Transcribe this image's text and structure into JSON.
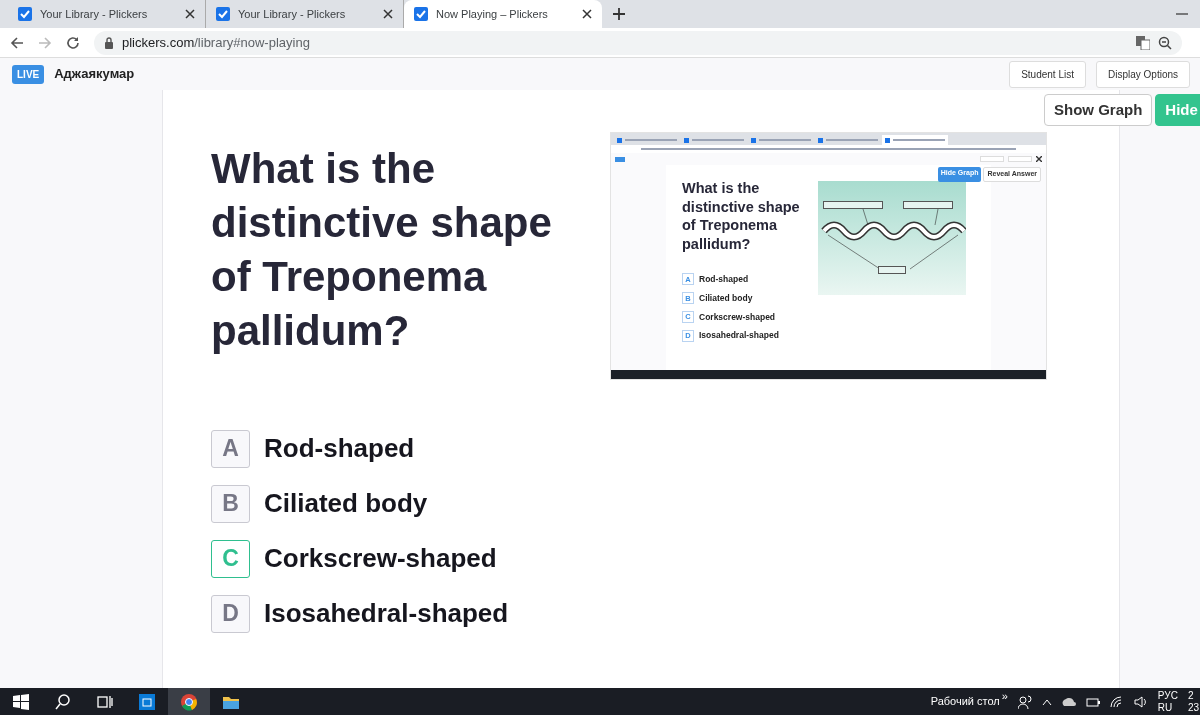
{
  "browser": {
    "tabs": [
      {
        "title": "Your Library - Plickers",
        "selected": false
      },
      {
        "title": "Your Library - Plickers",
        "selected": false
      },
      {
        "title": "Now Playing – Plickers",
        "selected": true
      }
    ],
    "url_host": "plickers.com",
    "url_path": "/library#now-playing"
  },
  "header": {
    "badge": "LIVE",
    "class_name": "Аджаякумар",
    "buttons": [
      "Student List",
      "Display Options"
    ]
  },
  "stage_buttons": [
    {
      "label": "Show Graph",
      "kind": "outline"
    },
    {
      "label": "Hide",
      "kind": "filled"
    }
  ],
  "question": "What is the distinctive shape of Treponema pallidum?",
  "choices": [
    {
      "letter": "A",
      "text": "Rod-shaped",
      "highlighted": false
    },
    {
      "letter": "B",
      "text": "Ciliated body",
      "highlighted": false
    },
    {
      "letter": "C",
      "text": "Corkscrew-shaped",
      "highlighted": true
    },
    {
      "letter": "D",
      "text": "Isosahedral-shaped",
      "highlighted": false
    }
  ],
  "inner_screen": {
    "tabs": [
      {
        "selected": false
      },
      {
        "selected": false
      },
      {
        "selected": false
      },
      {
        "selected": false
      },
      {
        "selected": true
      }
    ],
    "stage_buttons": [
      {
        "label": "Hide Graph",
        "kind": "filled"
      },
      {
        "label": "Reveal Answer",
        "kind": "outline"
      }
    ],
    "question": "What is the distinctive shape of Treponema pallidum?",
    "choices": [
      {
        "letter": "A",
        "text": "Rod-shaped"
      },
      {
        "letter": "B",
        "text": "Ciliated body"
      },
      {
        "letter": "C",
        "text": "Corkscrew-shaped"
      },
      {
        "letter": "D",
        "text": "Isosahedral-shaped"
      }
    ]
  },
  "taskbar": {
    "desktop_label": "Рабочий стол",
    "chevron": "»",
    "language": [
      "РУС",
      "RU"
    ],
    "clock": [
      "2",
      "23"
    ]
  }
}
